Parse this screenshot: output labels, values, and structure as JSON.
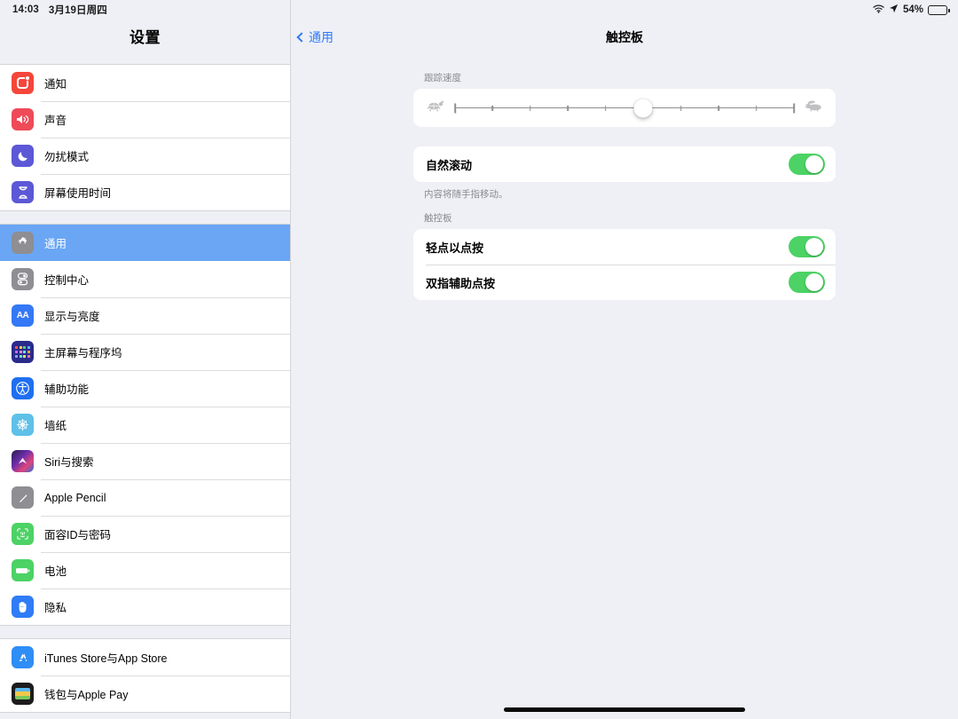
{
  "status_bar": {
    "time": "14:03",
    "date": "3月19日周四",
    "wifi_icon": "wifi-icon",
    "location_icon": "location-arrow-icon",
    "battery_percent": "54%",
    "battery_level": 54
  },
  "sidebar": {
    "title": "设置",
    "groups": [
      {
        "items": [
          {
            "label": "通知",
            "icon": "notifications-icon",
            "selected": false
          },
          {
            "label": "声音",
            "icon": "sound-icon",
            "selected": false
          },
          {
            "label": "勿扰模式",
            "icon": "do-not-disturb-icon",
            "selected": false
          },
          {
            "label": "屏幕使用时间",
            "icon": "screen-time-icon",
            "selected": false
          }
        ]
      },
      {
        "items": [
          {
            "label": "通用",
            "icon": "general-gear-icon",
            "selected": true
          },
          {
            "label": "控制中心",
            "icon": "control-center-icon",
            "selected": false
          },
          {
            "label": "显示与亮度",
            "icon": "display-brightness-icon",
            "selected": false
          },
          {
            "label": "主屏幕与程序坞",
            "icon": "home-screen-dock-icon",
            "selected": false
          },
          {
            "label": "辅助功能",
            "icon": "accessibility-icon",
            "selected": false
          },
          {
            "label": "墙纸",
            "icon": "wallpaper-icon",
            "selected": false
          },
          {
            "label": "Siri与搜索",
            "icon": "siri-search-icon",
            "selected": false
          },
          {
            "label": "Apple Pencil",
            "icon": "apple-pencil-icon",
            "selected": false
          },
          {
            "label": "面容ID与密码",
            "icon": "face-id-icon",
            "selected": false
          },
          {
            "label": "电池",
            "icon": "battery-icon",
            "selected": false
          },
          {
            "label": "隐私",
            "icon": "privacy-hand-icon",
            "selected": false
          }
        ]
      },
      {
        "items": [
          {
            "label": "iTunes Store与App Store",
            "icon": "app-store-icon",
            "selected": false
          },
          {
            "label": "钱包与Apple Pay",
            "icon": "wallet-apple-pay-icon",
            "selected": false
          }
        ]
      }
    ]
  },
  "detail": {
    "back_label": "通用",
    "title": "触控板",
    "tracking_speed": {
      "header": "跟踪速度",
      "slow_icon": "turtle-icon",
      "fast_icon": "rabbit-icon",
      "value": 5,
      "min": 0,
      "max": 9,
      "ticks": 10
    },
    "natural_scroll": {
      "label": "自然滚动",
      "enabled": true,
      "footer": "内容将随手指移动。"
    },
    "trackpad_section": {
      "header": "触控板",
      "rows": [
        {
          "label": "轻点以点按",
          "enabled": true
        },
        {
          "label": "双指辅助点按",
          "enabled": true
        }
      ]
    }
  },
  "colors": {
    "accent_blue": "#2f7cf6",
    "selected_row": "#6aa6f4",
    "toggle_green": "#4cd265",
    "background": "#eff0f5"
  }
}
